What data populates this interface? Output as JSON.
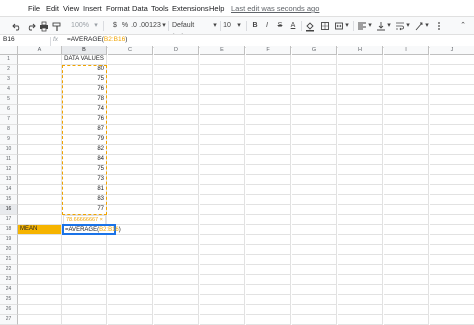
{
  "menu": {
    "items": [
      "File",
      "Edit",
      "View",
      "Insert",
      "Format",
      "Data",
      "Tools",
      "Extensions",
      "Help"
    ],
    "last_edit": "Last edit was seconds ago"
  },
  "toolbar": {
    "zoom": "100%",
    "currency": "$",
    "percent": "%",
    "decimal_decrease": ".0",
    "decimal_increase": ".00",
    "more_formats": "123",
    "font": "Default (Ari...",
    "font_size": "10",
    "bold": "B",
    "italic": "I",
    "strikethrough": "S",
    "text_color": "A"
  },
  "formula_bar": {
    "name_box": "B16",
    "fx": "fx",
    "formula_prefix": "=AVERAGE(",
    "formula_range": "B2:B16",
    "formula_suffix": ")"
  },
  "grid": {
    "columns": [
      "A",
      "B",
      "C",
      "D",
      "E",
      "F",
      "G",
      "H",
      "I",
      "J"
    ],
    "rows": [
      "1",
      "2",
      "3",
      "4",
      "5",
      "6",
      "7",
      "8",
      "9",
      "10",
      "11",
      "12",
      "13",
      "14",
      "15",
      "16",
      "17",
      "18",
      "19",
      "20",
      "21",
      "22",
      "23",
      "24",
      "25",
      "26",
      "27"
    ],
    "header_label": "DATA VALUES",
    "values": [
      "80",
      "75",
      "76",
      "78",
      "74",
      "76",
      "87",
      "79",
      "82",
      "84",
      "75",
      "73",
      "81",
      "83",
      "77"
    ],
    "mean_label": "MEAN",
    "preview_value": "78.66666667",
    "preview_close": "×",
    "active_prefix": "=AVERAGE(",
    "active_range": "B2:B16",
    "active_suffix": ")"
  },
  "colors": {
    "mean_fill": "#f6b400",
    "range_highlight": "#f0a300",
    "active_border": "#1a73e8"
  }
}
